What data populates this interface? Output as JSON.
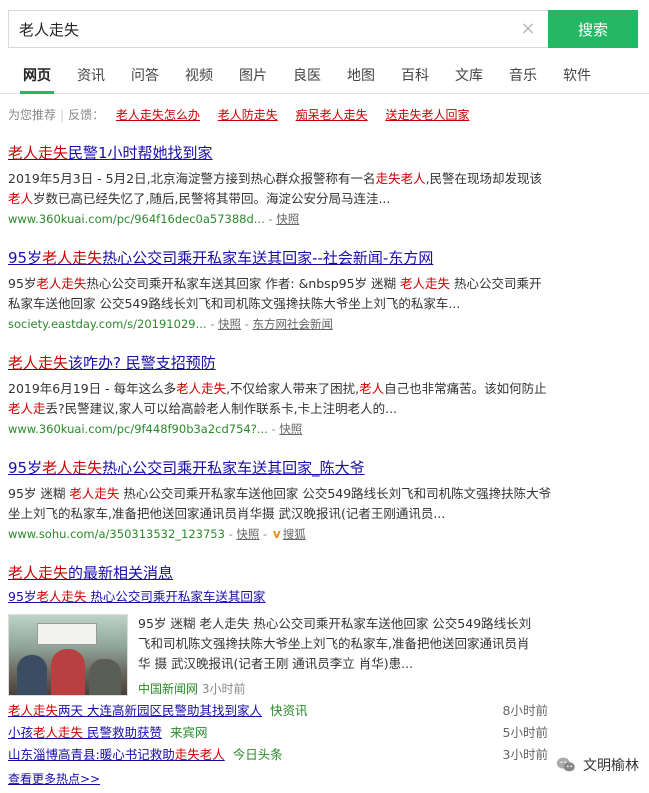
{
  "search": {
    "query": "老人走失",
    "button": "搜索",
    "clear": "×"
  },
  "tabs": [
    "网页",
    "资讯",
    "问答",
    "视频",
    "图片",
    "良医",
    "地图",
    "百科",
    "文库",
    "音乐",
    "软件"
  ],
  "recommend": {
    "label": "为您推荐",
    "sep": "|",
    "feedback": "反馈：",
    "links": [
      "老人走失怎么办",
      "老人防走失",
      "痴呆老人走失",
      "送走失老人回家"
    ]
  },
  "results": [
    {
      "title_hl": "老人走失",
      "title_rest": "民警1小时帮她找到家",
      "desc_html": "2019年5月3日 - 5月2日,北京海淀警方接到热心群众报警称有一名<span class=\"hl\">走失老人</span>,民警在现场却发现该<span class=\"hl\">老人</span>岁数已高已经失忆了,随后,民警将其带回。海淀公安分局马连洼...",
      "url": "www.360kuai.com/pc/964f16dec0a57388d...",
      "dash": " - ",
      "snapshot": "快照"
    },
    {
      "title_pre": "95岁",
      "title_hl": "老人走失",
      "title_rest": "热心公交司乘开私家车送其回家--社会新闻-东方网",
      "desc_html": "95岁<span class=\"hl\">老人走失</span>热心公交司乘开私家车送其回家 作者: &amp;nbsp95岁 迷糊 <span class=\"hl\">老人走失</span> 热心公交司乘开私家车送他回家 公交549路线长刘飞和司机陈文强搀扶陈大爷坐上刘飞的私家车...",
      "url": "society.eastday.com/s/20191029...",
      "dash": " - ",
      "snapshot": "快照",
      "source": "东方网社会新闻"
    },
    {
      "title_hl": "老人走失",
      "title_rest": "该咋办? 民警支招预防",
      "desc_html": "2019年6月19日 - 每年这么多<span class=\"hl\">老人走失</span>,不仅给家人带来了困扰,<span class=\"hl\">老人</span>自己也非常痛苦。该如何防止<span class=\"hl\">老人走</span>丢?民警建议,家人可以给高龄老人制作联系卡,卡上注明老人的...",
      "url": "www.360kuai.com/pc/9f448f90b3a2cd754?...",
      "dash": " - ",
      "snapshot": "快照"
    },
    {
      "title_pre": "95岁",
      "title_hl": "老人走失",
      "title_rest": "热心公交司乘开私家车送其回家_陈大爷",
      "desc_html": "95岁 迷糊 <span class=\"hl\">老人走失</span> 热心公交司乘开私家车送他回家 公交549路线长刘飞和司机陈文强搀扶陈大爷坐上刘飞的私家车,准备把他送回家通讯员肖华摄 武汉晚报讯(记者王刚通讯员...",
      "url": "www.sohu.com/a/350313532_123753",
      "dash": " - ",
      "snapshot": "快照",
      "v": "v",
      "source": "搜狐"
    }
  ],
  "news": {
    "title_hl": "老人走失",
    "title_rest": "的最新相关消息",
    "sub_pre": "95岁",
    "sub_hl": "老人走失",
    "sub_rest": " 热心公交司乘开私家车送其回家",
    "desc_html": "95岁 迷糊 老人走失 热心公交司乘开私家车送他回家 公交549路线长刘飞和司机陈文强搀扶陈大爷坐上刘飞的私家车,准备把他送回家通讯员肖华 摄 武汉晚报讯(记者王刚 通讯员李立 肖华)患...",
    "source": "中国新闻网",
    "time": "3小时前",
    "items": [
      {
        "hl": "老人走失",
        "rest": "两天 大连高新园区民警助其找到家人",
        "source": "快资讯",
        "time": "8小时前"
      },
      {
        "pre": "小孩",
        "hl": "老人走失",
        "rest": " 民警救助获赞",
        "source": "来宾网",
        "time": "5小时前"
      },
      {
        "pre": "山东淄博高青县:暖心书记救助",
        "hl": "走失老人",
        "rest": "",
        "source": "今日头条",
        "time": "3小时前"
      }
    ],
    "more": "查看更多热点>>"
  },
  "watermark": {
    "text": "文明榆林"
  },
  "colors": {
    "accent": "#25b864",
    "link": "#1a0dab",
    "highlight": "#cc0000",
    "url": "#2a8a2a"
  }
}
